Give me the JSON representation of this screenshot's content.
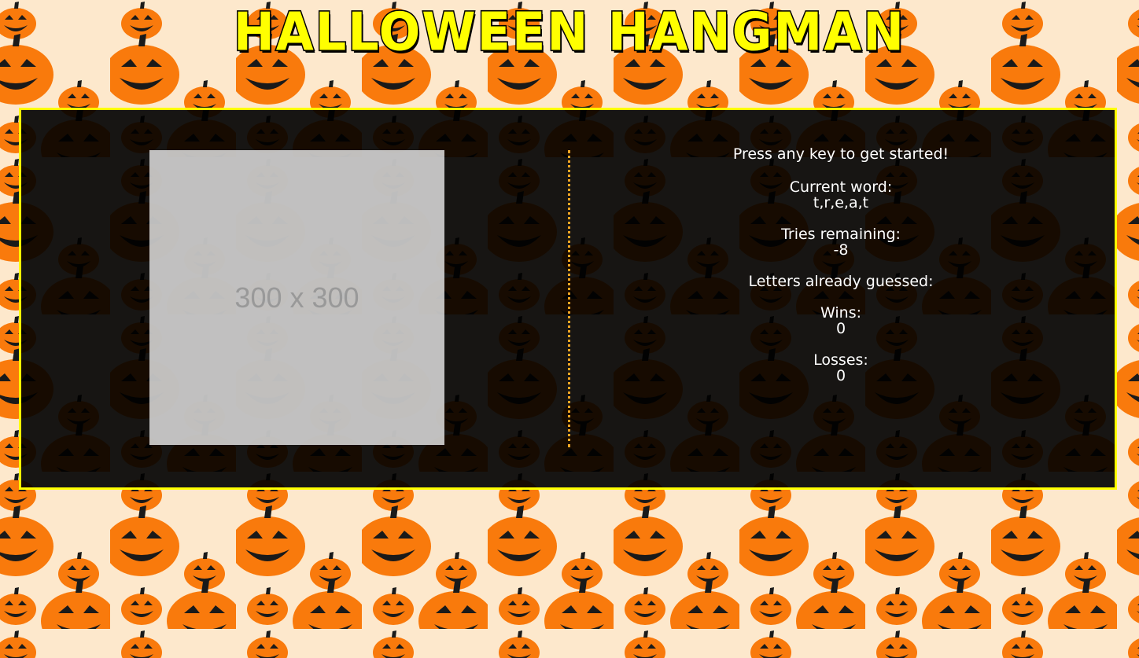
{
  "page": {
    "title": "HALLOWEEN HANGMAN"
  },
  "colors": {
    "background": "#fde8cc",
    "pumpkin": "#f97a0c",
    "panel_border": "#ffff00",
    "divider": "#f5a623",
    "title_fill": "#ffff00",
    "text": "#ffffff"
  },
  "image": {
    "placeholder_text": "300 x 300"
  },
  "info": {
    "prompt": "Press any key to get started!",
    "current_word_label": "Current word:",
    "current_word_value": "t,r,e,a,t",
    "tries_label": "Tries remaining:",
    "tries_value": "-8",
    "guessed_label": "Letters already guessed:",
    "guessed_value": "",
    "wins_label": "Wins:",
    "wins_value": "0",
    "losses_label": "Losses:",
    "losses_value": "0"
  },
  "icons": {
    "background": "pumpkin-icon"
  }
}
